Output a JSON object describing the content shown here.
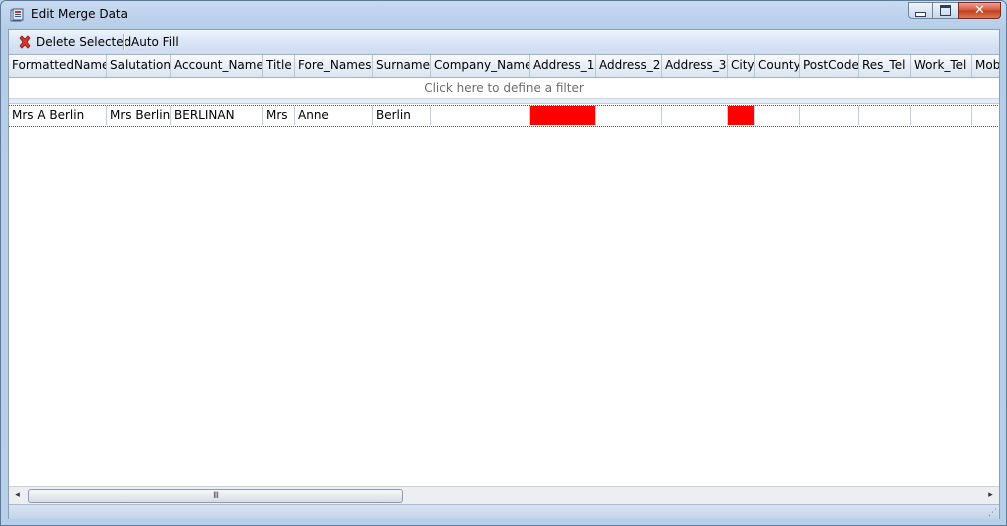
{
  "window": {
    "title": "Edit Merge Data",
    "close_glyph": "✕"
  },
  "toolbar": {
    "delete_label": "Delete Selected",
    "autofill_label": "Auto Fill"
  },
  "grid": {
    "columns": [
      {
        "key": "FormattedName",
        "label": "FormattedName"
      },
      {
        "key": "Salutation",
        "label": "Salutation"
      },
      {
        "key": "Account_Name",
        "label": "Account_Name"
      },
      {
        "key": "Title",
        "label": "Title"
      },
      {
        "key": "Fore_Names",
        "label": "Fore_Names"
      },
      {
        "key": "Surname",
        "label": "Surname"
      },
      {
        "key": "Company_Name",
        "label": "Company_Name"
      },
      {
        "key": "Address_1",
        "label": "Address_1"
      },
      {
        "key": "Address_2",
        "label": "Address_2"
      },
      {
        "key": "Address_3",
        "label": "Address_3"
      },
      {
        "key": "City",
        "label": "City"
      },
      {
        "key": "County",
        "label": "County"
      },
      {
        "key": "PostCode",
        "label": "PostCode"
      },
      {
        "key": "Res_Tel",
        "label": "Res_Tel"
      },
      {
        "key": "Work_Tel",
        "label": "Work_Tel"
      },
      {
        "key": "Mobi",
        "label": "Mobi"
      }
    ],
    "filter_text": "Click here to define a filter",
    "rows": [
      {
        "cells": [
          "Mrs A Berlin",
          "Mrs Berlin",
          "BERLINAN",
          "Mrs",
          "Anne",
          "Berlin",
          "",
          "",
          "",
          "",
          "",
          "",
          "",
          "",
          "",
          ""
        ],
        "error_columns": [
          "Address_1",
          "City"
        ]
      }
    ],
    "error_color": "#ff0000"
  },
  "scrollbar": {
    "left_arrow": "◂",
    "right_arrow": "▸",
    "grip": "III"
  },
  "statusbar": {
    "grip": "⋰"
  }
}
